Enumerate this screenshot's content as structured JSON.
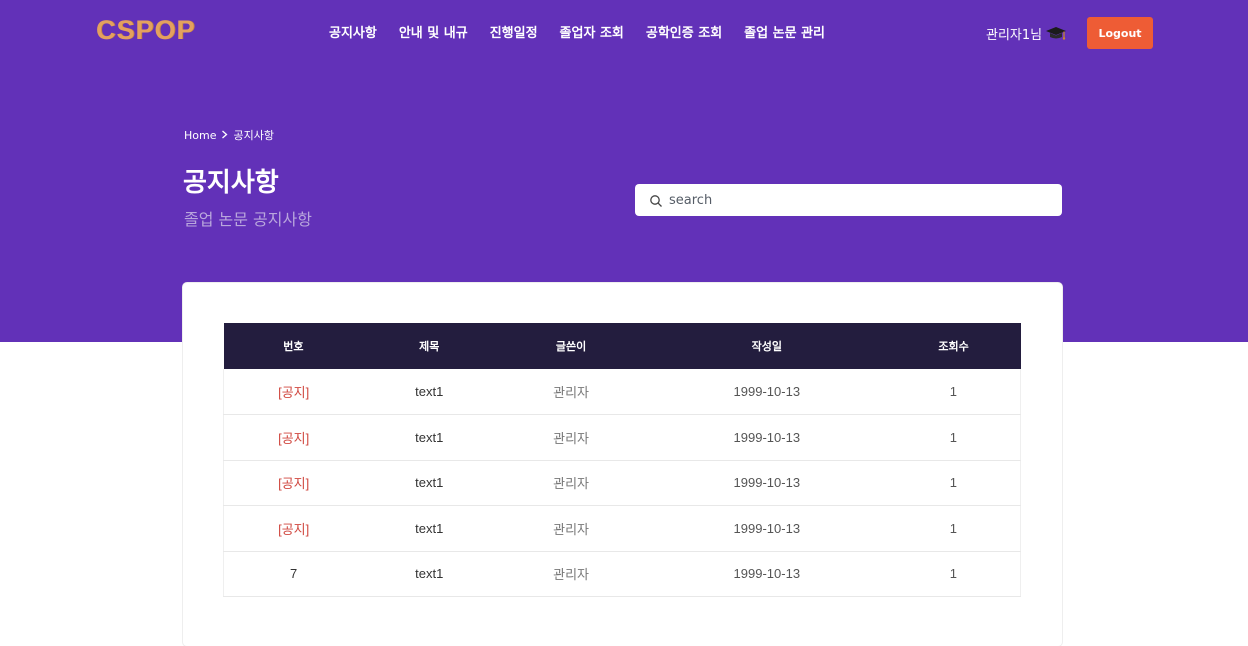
{
  "brand": {
    "logo_text": "CSPOP",
    "logo_color": "#e3a15f"
  },
  "colors": {
    "hero_bg": "#6231b8",
    "accent": "#ee5c35",
    "table_header_bg": "#231d3e",
    "notice": "#d0473f"
  },
  "nav": {
    "items": [
      "공지사항",
      "안내 및 내규",
      "진행일정",
      "졸업자 조회",
      "공학인증 조회",
      "졸업 논문 관리"
    ]
  },
  "user": {
    "greeting": "관리자1님",
    "icon": "graduation-cap-icon",
    "logout_label": "Logout"
  },
  "breadcrumb": {
    "home": "Home",
    "current": "공지사항"
  },
  "page": {
    "title": "공지사항",
    "subtitle": "졸업 논문 공지사항"
  },
  "search": {
    "placeholder": "search"
  },
  "table": {
    "headers": [
      "번호",
      "제목",
      "글쓴이",
      "작성일",
      "조회수"
    ],
    "rows": [
      {
        "num": "[공지]",
        "title": "text1",
        "author": "관리자",
        "date": "1999-10-13",
        "views": "1",
        "notice": true
      },
      {
        "num": "[공지]",
        "title": "text1",
        "author": "관리자",
        "date": "1999-10-13",
        "views": "1",
        "notice": true
      },
      {
        "num": "[공지]",
        "title": "text1",
        "author": "관리자",
        "date": "1999-10-13",
        "views": "1",
        "notice": true
      },
      {
        "num": "[공지]",
        "title": "text1",
        "author": "관리자",
        "date": "1999-10-13",
        "views": "1",
        "notice": true
      },
      {
        "num": "7",
        "title": "text1",
        "author": "관리자",
        "date": "1999-10-13",
        "views": "1",
        "notice": false
      }
    ]
  }
}
